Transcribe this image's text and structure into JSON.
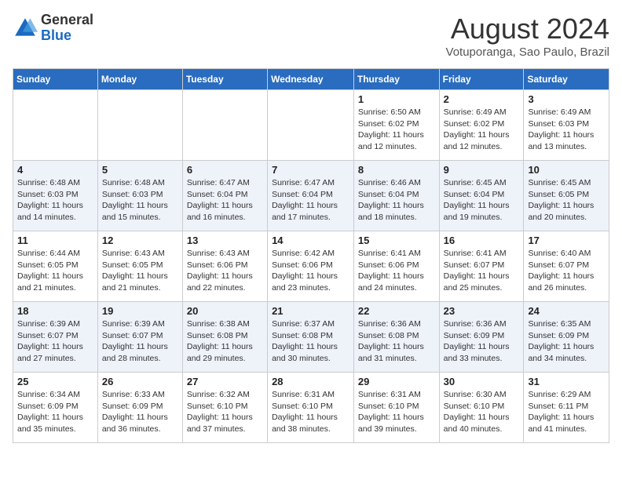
{
  "logo": {
    "general": "General",
    "blue": "Blue"
  },
  "header": {
    "month": "August 2024",
    "location": "Votuporanga, Sao Paulo, Brazil"
  },
  "weekdays": [
    "Sunday",
    "Monday",
    "Tuesday",
    "Wednesday",
    "Thursday",
    "Friday",
    "Saturday"
  ],
  "weeks": [
    [
      {
        "day": "",
        "info": ""
      },
      {
        "day": "",
        "info": ""
      },
      {
        "day": "",
        "info": ""
      },
      {
        "day": "",
        "info": ""
      },
      {
        "day": "1",
        "info": "Sunrise: 6:50 AM\nSunset: 6:02 PM\nDaylight: 11 hours and 12 minutes."
      },
      {
        "day": "2",
        "info": "Sunrise: 6:49 AM\nSunset: 6:02 PM\nDaylight: 11 hours and 12 minutes."
      },
      {
        "day": "3",
        "info": "Sunrise: 6:49 AM\nSunset: 6:03 PM\nDaylight: 11 hours and 13 minutes."
      }
    ],
    [
      {
        "day": "4",
        "info": "Sunrise: 6:48 AM\nSunset: 6:03 PM\nDaylight: 11 hours and 14 minutes."
      },
      {
        "day": "5",
        "info": "Sunrise: 6:48 AM\nSunset: 6:03 PM\nDaylight: 11 hours and 15 minutes."
      },
      {
        "day": "6",
        "info": "Sunrise: 6:47 AM\nSunset: 6:04 PM\nDaylight: 11 hours and 16 minutes."
      },
      {
        "day": "7",
        "info": "Sunrise: 6:47 AM\nSunset: 6:04 PM\nDaylight: 11 hours and 17 minutes."
      },
      {
        "day": "8",
        "info": "Sunrise: 6:46 AM\nSunset: 6:04 PM\nDaylight: 11 hours and 18 minutes."
      },
      {
        "day": "9",
        "info": "Sunrise: 6:45 AM\nSunset: 6:04 PM\nDaylight: 11 hours and 19 minutes."
      },
      {
        "day": "10",
        "info": "Sunrise: 6:45 AM\nSunset: 6:05 PM\nDaylight: 11 hours and 20 minutes."
      }
    ],
    [
      {
        "day": "11",
        "info": "Sunrise: 6:44 AM\nSunset: 6:05 PM\nDaylight: 11 hours and 21 minutes."
      },
      {
        "day": "12",
        "info": "Sunrise: 6:43 AM\nSunset: 6:05 PM\nDaylight: 11 hours and 21 minutes."
      },
      {
        "day": "13",
        "info": "Sunrise: 6:43 AM\nSunset: 6:06 PM\nDaylight: 11 hours and 22 minutes."
      },
      {
        "day": "14",
        "info": "Sunrise: 6:42 AM\nSunset: 6:06 PM\nDaylight: 11 hours and 23 minutes."
      },
      {
        "day": "15",
        "info": "Sunrise: 6:41 AM\nSunset: 6:06 PM\nDaylight: 11 hours and 24 minutes."
      },
      {
        "day": "16",
        "info": "Sunrise: 6:41 AM\nSunset: 6:07 PM\nDaylight: 11 hours and 25 minutes."
      },
      {
        "day": "17",
        "info": "Sunrise: 6:40 AM\nSunset: 6:07 PM\nDaylight: 11 hours and 26 minutes."
      }
    ],
    [
      {
        "day": "18",
        "info": "Sunrise: 6:39 AM\nSunset: 6:07 PM\nDaylight: 11 hours and 27 minutes."
      },
      {
        "day": "19",
        "info": "Sunrise: 6:39 AM\nSunset: 6:07 PM\nDaylight: 11 hours and 28 minutes."
      },
      {
        "day": "20",
        "info": "Sunrise: 6:38 AM\nSunset: 6:08 PM\nDaylight: 11 hours and 29 minutes."
      },
      {
        "day": "21",
        "info": "Sunrise: 6:37 AM\nSunset: 6:08 PM\nDaylight: 11 hours and 30 minutes."
      },
      {
        "day": "22",
        "info": "Sunrise: 6:36 AM\nSunset: 6:08 PM\nDaylight: 11 hours and 31 minutes."
      },
      {
        "day": "23",
        "info": "Sunrise: 6:36 AM\nSunset: 6:09 PM\nDaylight: 11 hours and 33 minutes."
      },
      {
        "day": "24",
        "info": "Sunrise: 6:35 AM\nSunset: 6:09 PM\nDaylight: 11 hours and 34 minutes."
      }
    ],
    [
      {
        "day": "25",
        "info": "Sunrise: 6:34 AM\nSunset: 6:09 PM\nDaylight: 11 hours and 35 minutes."
      },
      {
        "day": "26",
        "info": "Sunrise: 6:33 AM\nSunset: 6:09 PM\nDaylight: 11 hours and 36 minutes."
      },
      {
        "day": "27",
        "info": "Sunrise: 6:32 AM\nSunset: 6:10 PM\nDaylight: 11 hours and 37 minutes."
      },
      {
        "day": "28",
        "info": "Sunrise: 6:31 AM\nSunset: 6:10 PM\nDaylight: 11 hours and 38 minutes."
      },
      {
        "day": "29",
        "info": "Sunrise: 6:31 AM\nSunset: 6:10 PM\nDaylight: 11 hours and 39 minutes."
      },
      {
        "day": "30",
        "info": "Sunrise: 6:30 AM\nSunset: 6:10 PM\nDaylight: 11 hours and 40 minutes."
      },
      {
        "day": "31",
        "info": "Sunrise: 6:29 AM\nSunset: 6:11 PM\nDaylight: 11 hours and 41 minutes."
      }
    ]
  ]
}
